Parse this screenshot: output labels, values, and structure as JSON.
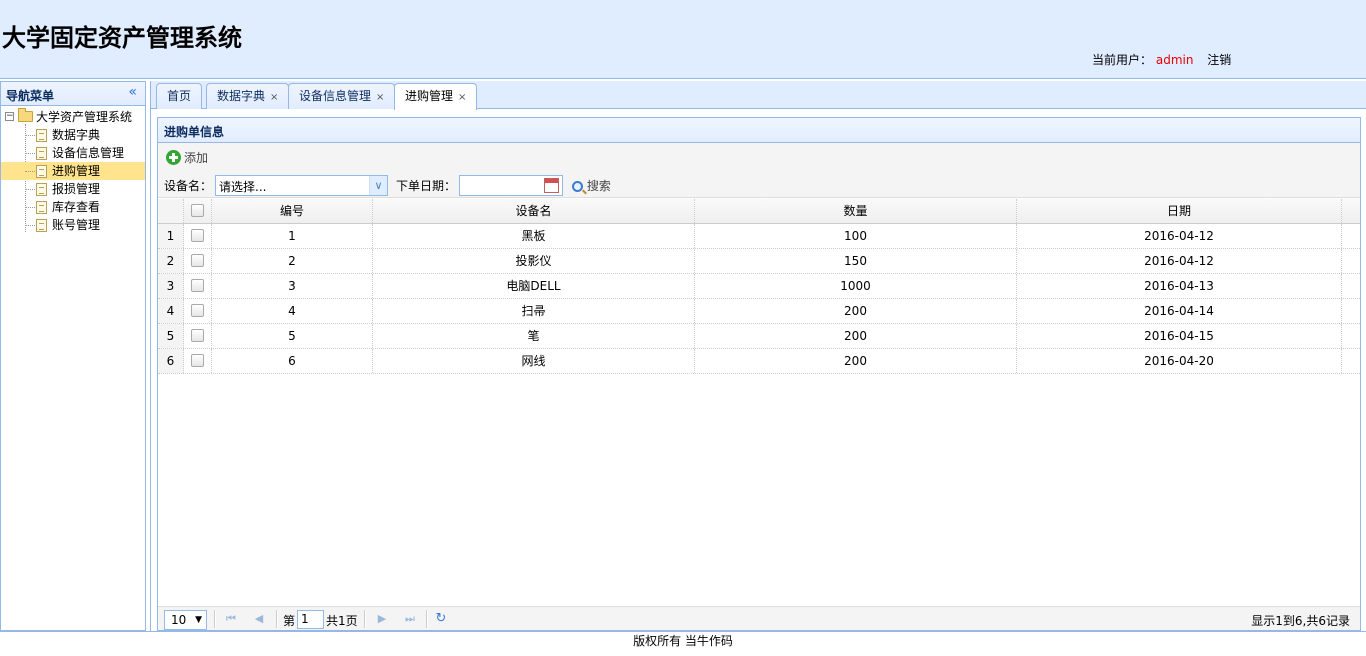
{
  "header": {
    "title": "大学固定资产管理系统",
    "user_label": "当前用户：",
    "user_name": "admin",
    "logout": "注销"
  },
  "nav": {
    "title": "导航菜单",
    "collapse": "«",
    "root": {
      "toggle": "−",
      "label": "大学资产管理系统"
    },
    "items": [
      {
        "label": "数据字典"
      },
      {
        "label": "设备信息管理"
      },
      {
        "label": "进购管理",
        "selected": true
      },
      {
        "label": "报损管理"
      },
      {
        "label": "库存查看"
      },
      {
        "label": "账号管理"
      }
    ]
  },
  "tabs": [
    {
      "label": "首页",
      "closable": false
    },
    {
      "label": "数据字典",
      "closable": true
    },
    {
      "label": "设备信息管理",
      "closable": true
    },
    {
      "label": "进购管理",
      "closable": true,
      "active": true
    }
  ],
  "tab_close": "×",
  "panel": {
    "title": "进购单信息",
    "add_label": "添加",
    "filter": {
      "device_label": "设备名：",
      "device_value": "请选择...",
      "combo_arrow": "∨",
      "date_label": "下单日期：",
      "date_value": "",
      "search_label": "搜索"
    }
  },
  "grid": {
    "columns": [
      "编号",
      "设备名",
      "数量",
      "日期"
    ],
    "rows": [
      {
        "n": "1",
        "id": "1",
        "name": "黑板",
        "qty": "100",
        "date": "2016-04-12"
      },
      {
        "n": "2",
        "id": "2",
        "name": "投影仪",
        "qty": "150",
        "date": "2016-04-12"
      },
      {
        "n": "3",
        "id": "3",
        "name": "电脑DELL",
        "qty": "1000",
        "date": "2016-04-13"
      },
      {
        "n": "4",
        "id": "4",
        "name": "扫帚",
        "qty": "200",
        "date": "2016-04-14"
      },
      {
        "n": "5",
        "id": "5",
        "name": "笔",
        "qty": "200",
        "date": "2016-04-15"
      },
      {
        "n": "6",
        "id": "6",
        "name": "网线",
        "qty": "200",
        "date": "2016-04-20"
      }
    ]
  },
  "pager": {
    "page_size": "10",
    "page_size_arrow": "▼",
    "page_prefix": "第",
    "page_value": "1",
    "page_suffix": "共1页",
    "info": "显示1到6,共6记录",
    "icons": {
      "first": "first-page-icon",
      "prev": "prev-page-icon",
      "next": "next-page-icon",
      "last": "last-page-icon",
      "refresh": "refresh-icon"
    }
  },
  "footer": {
    "text": "版权所有  当牛作码"
  },
  "colors": {
    "header_bg": "#e0ecff",
    "border": "#95b8e7",
    "selected": "#ffe48d",
    "user_name": "#e60000"
  }
}
